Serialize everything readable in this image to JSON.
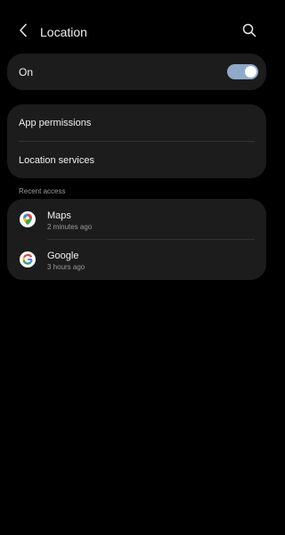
{
  "header": {
    "title": "Location",
    "back_icon": "chevron-left-icon",
    "search_icon": "search-icon"
  },
  "master_toggle": {
    "label": "On",
    "state": "on",
    "accent_color": "#8fa9c9"
  },
  "settings": [
    {
      "label": "App permissions"
    },
    {
      "label": "Location services"
    }
  ],
  "recent_access": {
    "header": "Recent access",
    "apps": [
      {
        "name": "Maps",
        "time": "2 minutes ago",
        "icon": "google-maps-icon"
      },
      {
        "name": "Google",
        "time": "3 hours ago",
        "icon": "google-icon"
      }
    ]
  }
}
